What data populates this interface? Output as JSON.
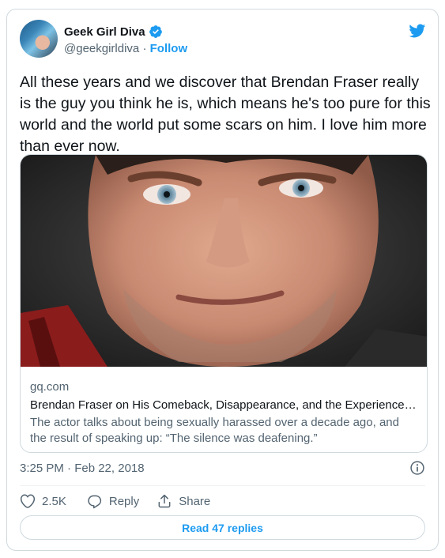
{
  "tweet": {
    "author": {
      "display_name": "Geek Girl Diva",
      "handle": "@geekgirldiva",
      "separator": "·",
      "follow_label": "Follow",
      "verified": true
    },
    "text": "All these years and we discover that Brendan Fraser really is the guy you think he is, which means he's too pure for this world and the world put some scars on him. I love him more than ever now.",
    "link_card": {
      "domain": "gq.com",
      "title": "Brendan Fraser on His Comeback, Disappearance, and the Experience th...",
      "description": "The actor talks about being sexually harassed over a decade ago, and the result of speaking up: “The silence was deafening.”"
    },
    "timestamp": "3:25 PM · Feb 22, 2018",
    "actions": {
      "like_count": "2.5K",
      "reply_label": "Reply",
      "share_label": "Share"
    },
    "read_replies_label": "Read 47 replies"
  },
  "colors": {
    "accent": "#1d9bf0",
    "text_primary": "#0f1419",
    "text_secondary": "#536471",
    "border": "#cfd9de"
  }
}
